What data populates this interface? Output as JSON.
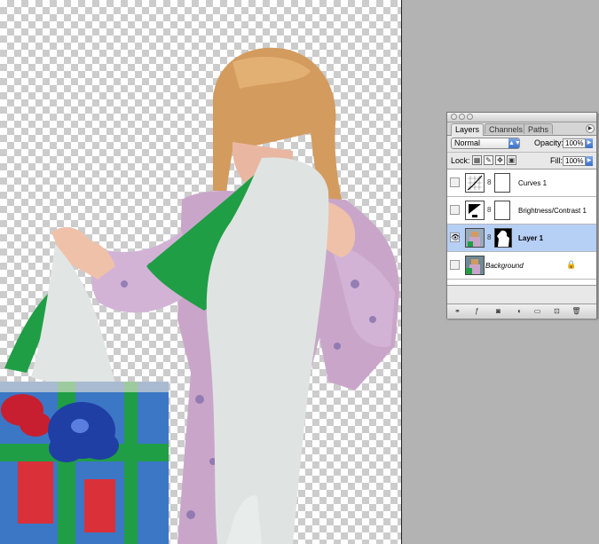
{
  "palette": {
    "tabs": [
      "Layers",
      "Channels",
      "Paths"
    ],
    "active_tab": "Layers",
    "blend_mode": "Normal",
    "opacity_label": "Opacity:",
    "opacity_value": "100%",
    "lock_label": "Lock:",
    "fill_label": "Fill:",
    "fill_value": "100%",
    "layers": [
      {
        "name": "Curves 1",
        "type": "adjustment-curves",
        "visible": false,
        "selected": false
      },
      {
        "name": "Brightness/Contrast 1",
        "type": "adjustment-brightness",
        "visible": false,
        "selected": false
      },
      {
        "name": "Layer 1",
        "type": "pixel-with-mask",
        "visible": true,
        "selected": true
      },
      {
        "name": "Background",
        "type": "background",
        "visible": false,
        "selected": false,
        "locked": true
      }
    ],
    "footer_icons": [
      "link-icon",
      "layer-style-icon",
      "mask-icon",
      "adjustment-icon",
      "folder-icon",
      "new-layer-icon",
      "trash-icon"
    ]
  },
  "colors": {
    "selection_highlight": "#b6cff5",
    "app_background": "#b3b3b3",
    "accent_blue": "#3a6fc7"
  }
}
